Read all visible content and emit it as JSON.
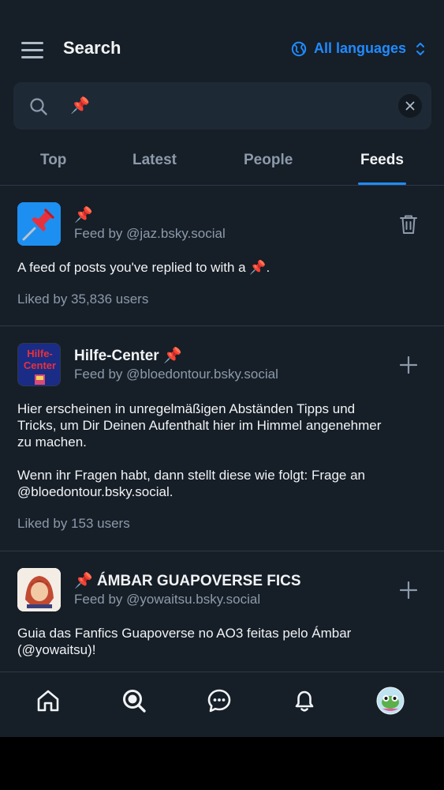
{
  "header": {
    "title": "Search",
    "language_label": "All languages"
  },
  "search": {
    "query": "📌"
  },
  "tabs": [
    "Top",
    "Latest",
    "People",
    "Feeds"
  ],
  "active_tab": "Feeds",
  "feeds": [
    {
      "title": "📌",
      "by": "Feed by @jaz.bsky.social",
      "description": [
        "A feed of posts you've replied to with a 📌."
      ],
      "likes": "Liked by 35,836 users",
      "action_icon": "trash-icon"
    },
    {
      "title": "Hilfe-Center 📌",
      "by": "Feed by @bloedontour.bsky.social",
      "avatar_text": "Hilfe-Center",
      "description": [
        "Hier erscheinen in unregelmäßigen Abständen Tipps und",
        "Tricks, um Dir Deinen Aufenthalt hier im Himmel angenehmer",
        "zu machen.",
        "",
        "Wenn ihr Fragen habt, dann stellt diese wie folgt: Frage an",
        "@bloedontour.bsky.social."
      ],
      "likes": "Liked by 153 users",
      "action_icon": "plus-icon"
    },
    {
      "title": "📌 ÁMBAR GUAPOVERSE FICS",
      "by": "Feed by @yowaitsu.bsky.social",
      "description": [
        "Guia das Fanfics Guapoverse no AO3 feitas pelo Ámbar",
        "(@yowaitsu)!"
      ],
      "action_icon": "plus-icon"
    }
  ],
  "nav": [
    "home-icon",
    "search-icon",
    "chat-icon",
    "bell-icon",
    "profile-avatar"
  ],
  "colors": {
    "background": "#161e27",
    "accent": "#208bfe",
    "muted": "#8c9aab",
    "divider": "#2e3a48"
  }
}
